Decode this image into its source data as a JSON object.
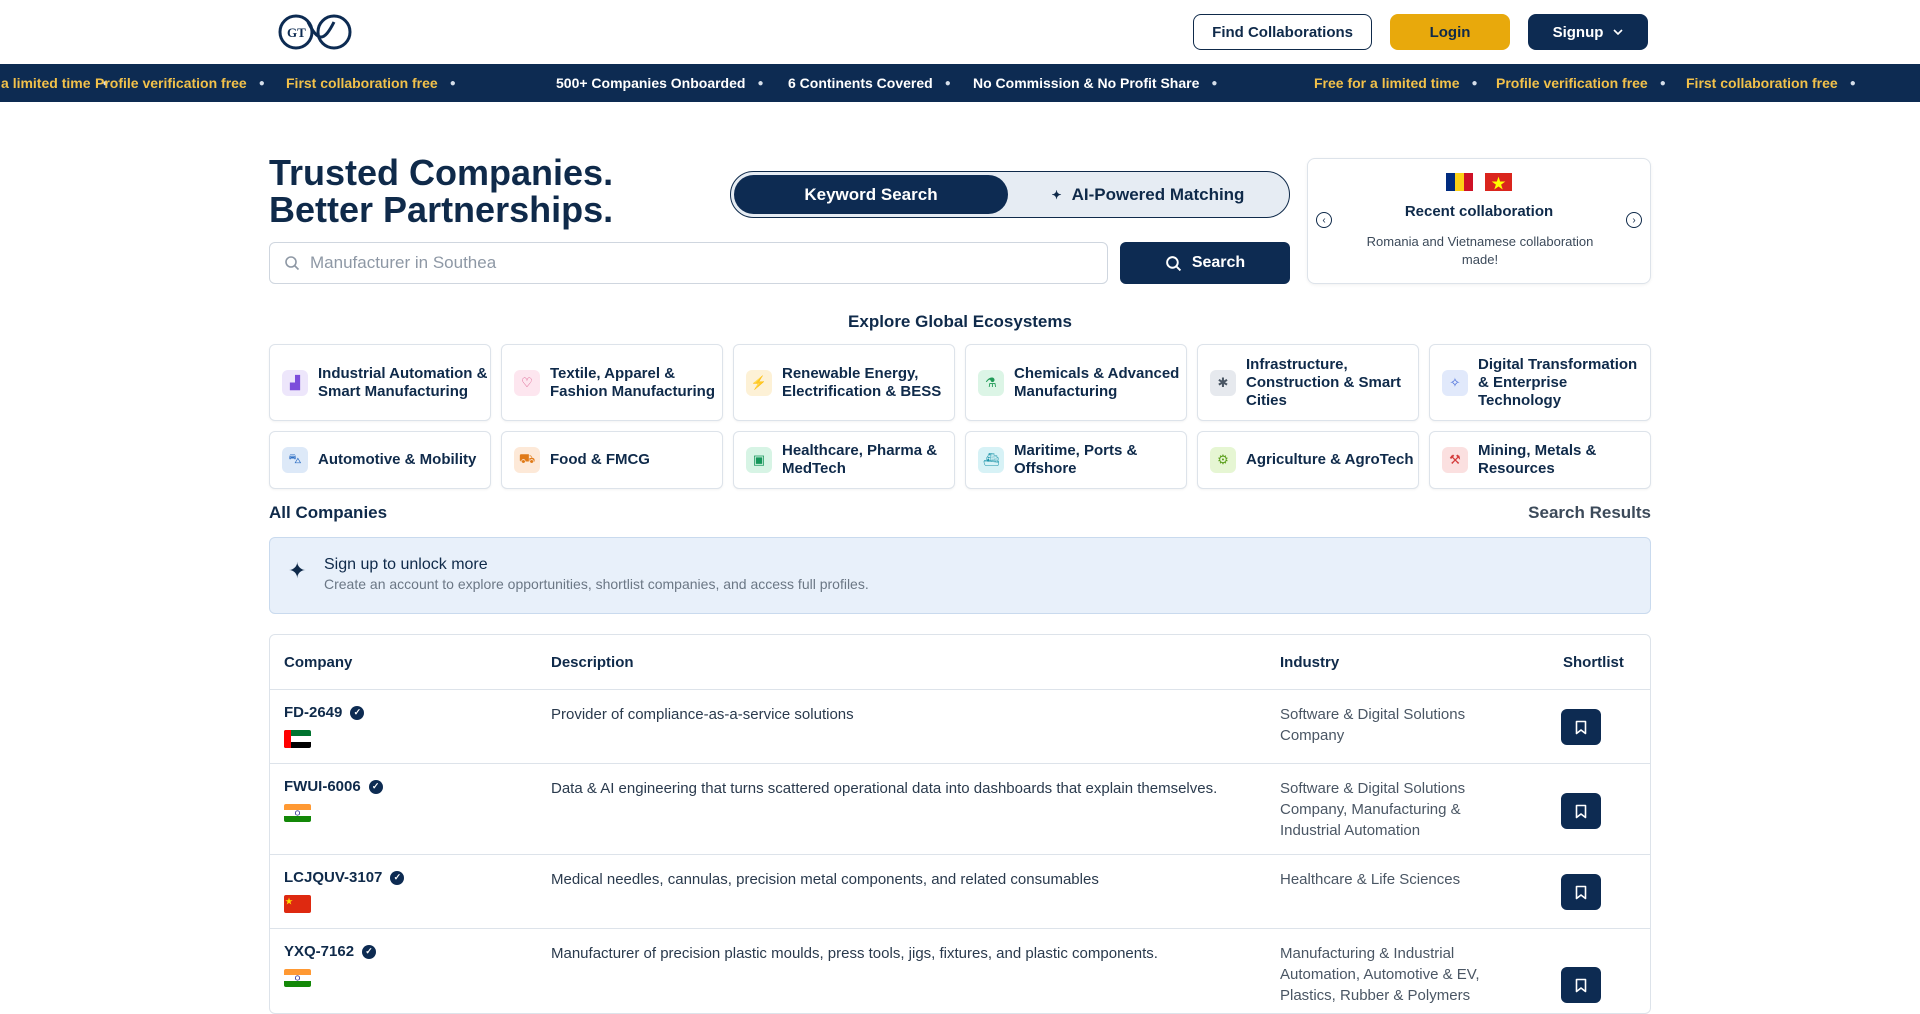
{
  "header": {
    "logo_text": "GT",
    "find_label": "Find Collaborations",
    "login_label": "Login",
    "signup_label": "Signup"
  },
  "ticker": [
    {
      "text": "Free for a limited time",
      "color": "yellow"
    },
    {
      "text": "Profile verification free",
      "color": "yellow"
    },
    {
      "text": "First collaboration free",
      "color": "yellow"
    },
    {
      "text": "500+ Companies Onboarded",
      "color": "white"
    },
    {
      "text": "6 Continents Covered",
      "color": "white"
    },
    {
      "text": "No Commission & No Profit Share",
      "color": "white"
    },
    {
      "text": "Free for a limited time",
      "color": "yellow"
    },
    {
      "text": "Profile verification free",
      "color": "yellow"
    },
    {
      "text": "First collaboration free",
      "color": "yellow"
    }
  ],
  "hero": {
    "title_line1": "Trusted Companies.",
    "title_line2": "Better Partnerships.",
    "tab_keyword": "Keyword Search",
    "tab_ai": "AI-Powered Matching",
    "search_placeholder": "Manufacturer in Southea",
    "search_button": "Search"
  },
  "recent": {
    "title": "Recent collaboration",
    "description": "Romania and Vietnamese collaboration made!",
    "flags": [
      "Romania",
      "Vietnam"
    ]
  },
  "ecosystems": {
    "title": "Explore Global Ecosystems",
    "items": [
      {
        "label": "Industrial Automation & Smart Manufacturing",
        "icon": "factory-icon",
        "bg": "#ede6fb",
        "fg": "#7c4ddb"
      },
      {
        "label": "Textile, Apparel & Fashion Manufacturing",
        "icon": "shirt-icon",
        "bg": "#fde6ef",
        "fg": "#d6427a"
      },
      {
        "label": "Renewable Energy, Electrification & BESS",
        "icon": "bolt-icon",
        "bg": "#fdf1d6",
        "fg": "#d99a08"
      },
      {
        "label": "Chemicals & Advanced Manufacturing",
        "icon": "flask-icon",
        "bg": "#dcf5e6",
        "fg": "#1f9a56"
      },
      {
        "label": "Infrastructure, Construction & Smart Cities",
        "icon": "gear-icon",
        "bg": "#e6e9ee",
        "fg": "#4a5664"
      },
      {
        "label": "Digital Transformation & Enterprise Technology",
        "icon": "sparkle-icon",
        "bg": "#e1e9fb",
        "fg": "#3f66d8"
      },
      {
        "label": "Automotive & Mobility",
        "icon": "car-icon",
        "bg": "#dde9f8",
        "fg": "#2e6fc4"
      },
      {
        "label": "Food & FMCG",
        "icon": "truck-icon",
        "bg": "#fde9d8",
        "fg": "#e07a18"
      },
      {
        "label": "Healthcare, Pharma & MedTech",
        "icon": "monitor-icon",
        "bg": "#d7f4e5",
        "fg": "#15965a"
      },
      {
        "label": "Maritime, Ports & Offshore",
        "icon": "ship-icon",
        "bg": "#d7f2f6",
        "fg": "#1a93a8"
      },
      {
        "label": "Agriculture & AgroTech",
        "icon": "tractor-icon",
        "bg": "#e6f6d3",
        "fg": "#5a9e1a"
      },
      {
        "label": "Mining, Metals & Resources",
        "icon": "pickaxe-icon",
        "bg": "#fbe0e0",
        "fg": "#d43b3b"
      }
    ]
  },
  "companies": {
    "heading": "All Companies",
    "results_label": "Search Results",
    "unlock_title": "Sign up to unlock more",
    "unlock_subtitle": "Create an account to explore opportunities, shortlist companies, and access full profiles.",
    "columns": [
      "Company",
      "Description",
      "Industry",
      "Shortlist"
    ],
    "rows": [
      {
        "name": "FD-2649",
        "flag": "UAE",
        "description": "Provider of compliance-as-a-service solutions",
        "industry": "Software & Digital Solutions Company"
      },
      {
        "name": "FWUI-6006",
        "flag": "India",
        "description": "Data & AI engineering that turns scattered operational data into dashboards that explain themselves.",
        "industry": "Software & Digital Solutions Company, Manufacturing & Industrial Automation"
      },
      {
        "name": "LCJQUV-3107",
        "flag": "China",
        "description": "Medical needles, cannulas, precision metal components, and related consumables",
        "industry": "Healthcare & Life Sciences"
      },
      {
        "name": "YXQ-7162",
        "flag": "India",
        "description": "Manufacturer of precision plastic moulds, press tools, jigs, fixtures, and plastic components.",
        "industry": "Manufacturing & Industrial Automation, Automotive & EV, Plastics, Rubber & Polymers"
      }
    ]
  }
}
